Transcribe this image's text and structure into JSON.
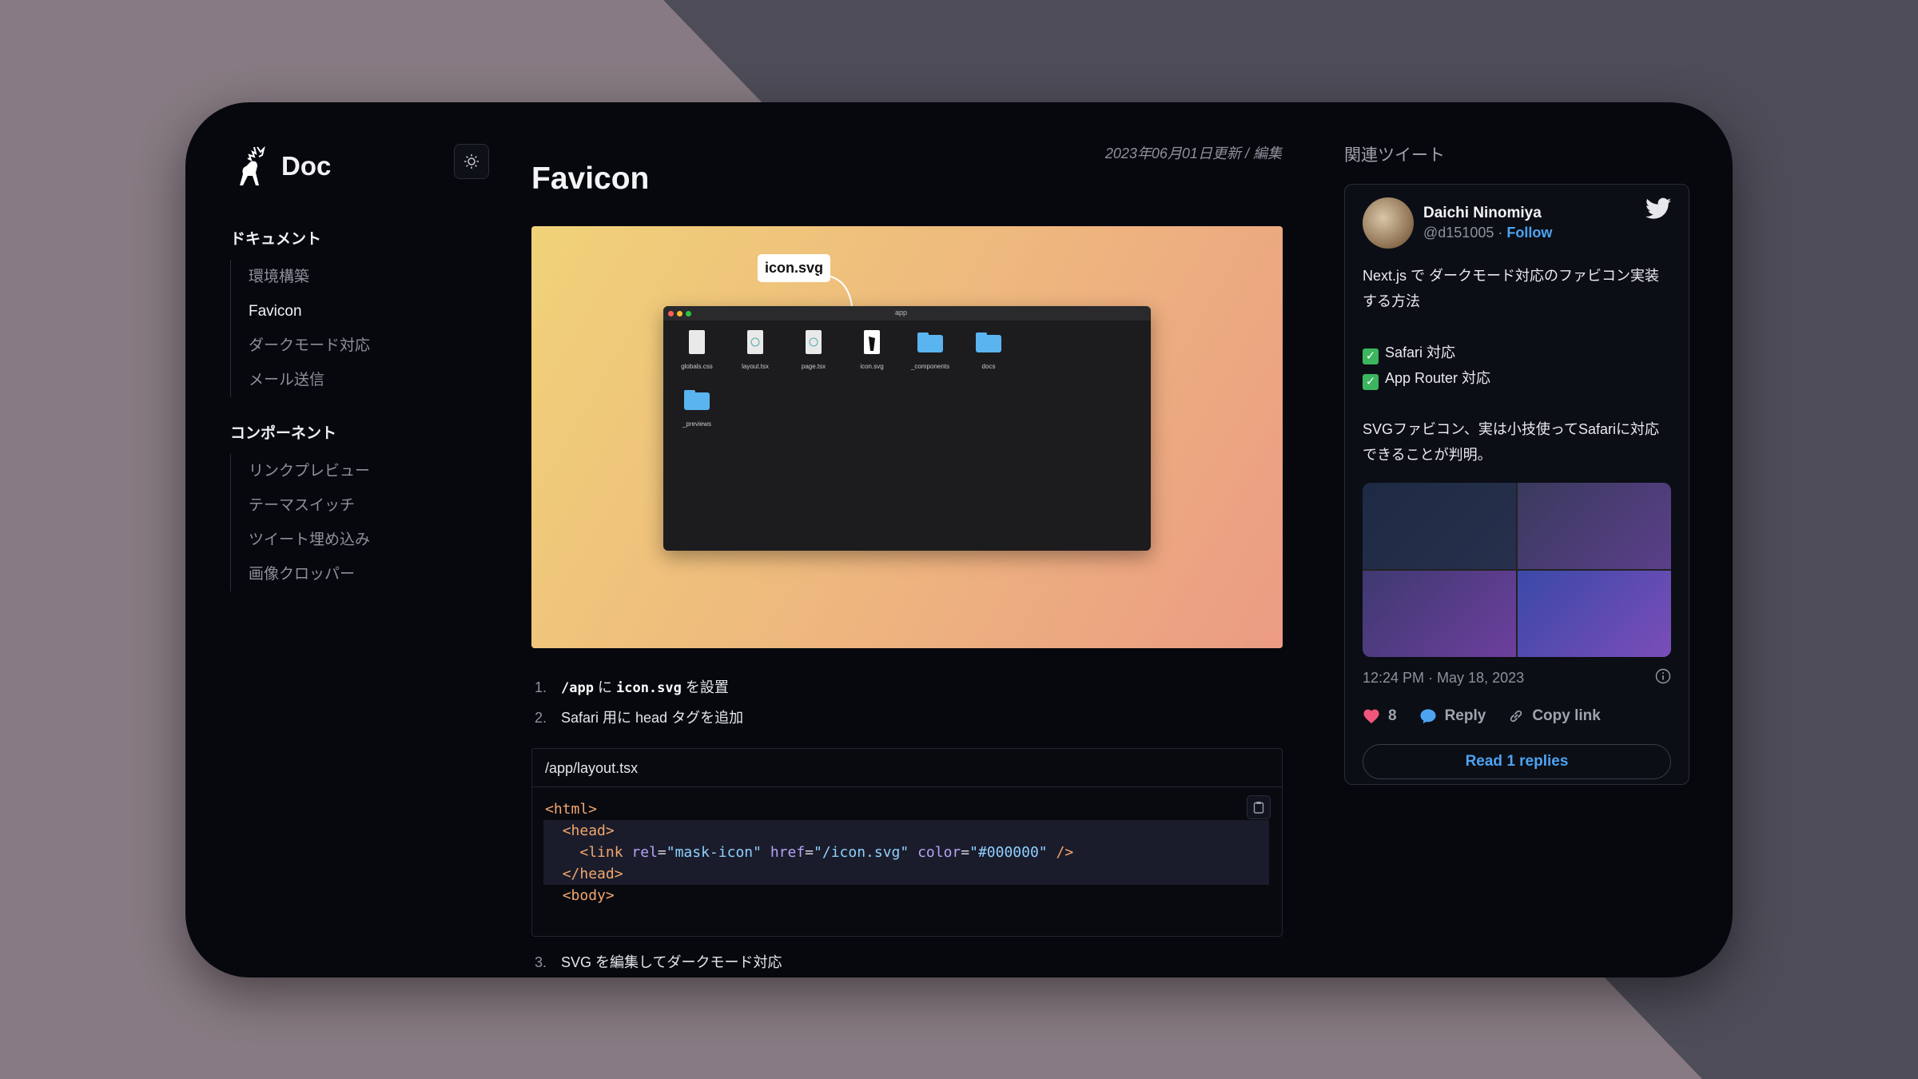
{
  "brand": {
    "name": "Doc"
  },
  "sidebar": {
    "sections": [
      {
        "title": "ドキュメント",
        "items": [
          {
            "label": "環境構築"
          },
          {
            "label": "Favicon",
            "active": true
          },
          {
            "label": "ダークモード対応"
          },
          {
            "label": "メール送信"
          }
        ]
      },
      {
        "title": "コンポーネント",
        "items": [
          {
            "label": "リンクプレビュー"
          },
          {
            "label": "テーマスイッチ"
          },
          {
            "label": "ツイート埋め込み"
          },
          {
            "label": "画像クロッパー"
          }
        ]
      }
    ]
  },
  "article": {
    "meta_date": "2023年06月01日更新",
    "meta_sep": "/",
    "meta_edit": "編集",
    "title": "Favicon",
    "hero": {
      "callout": "icon.svg",
      "finder_title": "app",
      "files": [
        "globals.css",
        "layout.tsx",
        "page.tsx",
        "icon.svg",
        "_components",
        "docs",
        "_previews"
      ]
    },
    "steps": [
      {
        "num": "1.",
        "parts": [
          "/app",
          "に",
          "icon.svg",
          "を設置"
        ]
      },
      {
        "num": "2.",
        "text": "Safari 用に head タグを追加"
      },
      {
        "num": "3.",
        "text": "SVG を編集してダークモード対応"
      }
    ],
    "code": {
      "filename": "/app/layout.tsx",
      "lines": [
        {
          "tag": "<html>"
        },
        {
          "indent": "  ",
          "tag": "<head>"
        },
        {
          "indent": "    ",
          "tag": "<link",
          "attr1": "rel",
          "val1": "\"mask-icon\"",
          "attr2": "href",
          "val2": "\"/icon.svg\"",
          "attr3": "color",
          "val3": "\"#000000\"",
          "close": "/>"
        },
        {
          "indent": "  ",
          "tag": "</head>"
        },
        {
          "indent": "  ",
          "tag": "<body>"
        }
      ]
    }
  },
  "related": {
    "title": "関連ツイート",
    "tweet": {
      "name": "Daichi Ninomiya",
      "handle": "@d151005",
      "dot": "·",
      "follow": "Follow",
      "text_line1": "Next.js で ダークモード対応のファビコン実装する方法",
      "check1": "Safari 対応",
      "check2": "App Router 対応",
      "text_line3": "SVGファビコン、実は小技使ってSafariに対応できることが判明。",
      "time": "12:24 PM · May 18, 2023",
      "likes": "8",
      "reply": "Reply",
      "copy_link": "Copy link",
      "read_replies": "Read 1 replies"
    }
  },
  "colors": {
    "accent": "#4da3f2",
    "background": "#06080e",
    "like": "#f0567a"
  }
}
